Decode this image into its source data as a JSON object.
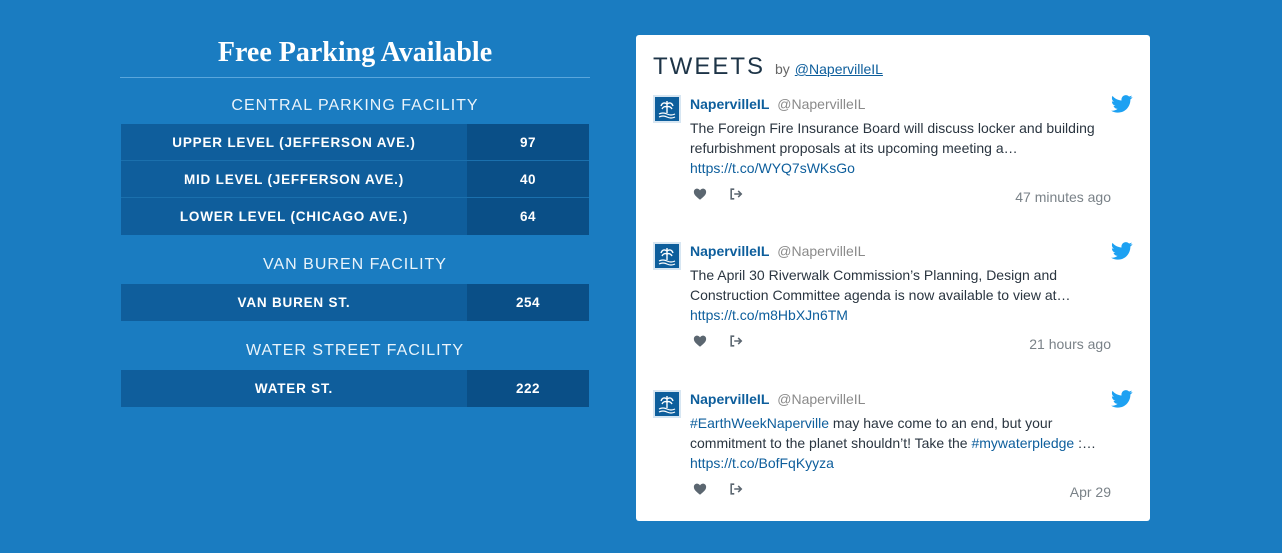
{
  "parking": {
    "title": "Free Parking Available",
    "facilities": [
      {
        "name": "CENTRAL PARKING FACILITY",
        "rows": [
          {
            "label": "UPPER LEVEL (JEFFERSON AVE.)",
            "count": "97"
          },
          {
            "label": "MID LEVEL (JEFFERSON AVE.)",
            "count": "40"
          },
          {
            "label": "LOWER LEVEL (CHICAGO AVE.)",
            "count": "64"
          }
        ]
      },
      {
        "name": "VAN BUREN FACILITY",
        "rows": [
          {
            "label": "VAN BUREN ST.",
            "count": "254"
          }
        ]
      },
      {
        "name": "WATER STREET FACILITY",
        "rows": [
          {
            "label": "WATER ST.",
            "count": "222"
          }
        ]
      }
    ]
  },
  "tweets": {
    "heading": "TWEETS",
    "by": "by",
    "handle": "@NapervilleIL",
    "items": [
      {
        "name": "NapervilleIL",
        "user": "@NapervilleIL",
        "text_parts": [
          {
            "t": "The Foreign Fire Insurance Board will discuss locker and building refurbishment proposals at its upcoming meeting a…",
            "link": false
          }
        ],
        "url": "https://t.co/WYQ7sWKsGo",
        "time": "47 minutes ago"
      },
      {
        "name": "NapervilleIL",
        "user": "@NapervilleIL",
        "text_parts": [
          {
            "t": "The April 30 Riverwalk Commission’s Planning, Design and Construction Committee agenda is now available to view at…",
            "link": false
          }
        ],
        "url": "https://t.co/m8HbXJn6TM",
        "time": "21 hours ago"
      },
      {
        "name": "NapervilleIL",
        "user": "@NapervilleIL",
        "text_parts": [
          {
            "t": "#EarthWeekNaperville",
            "link": true
          },
          {
            "t": " may have come to an end, but your commitment to the planet shouldn’t! Take the ",
            "link": false
          },
          {
            "t": "#mywaterpledge",
            "link": true
          },
          {
            "t": " :…",
            "link": false
          }
        ],
        "url": "https://t.co/BofFqKyyza",
        "time": "Apr 29"
      }
    ]
  },
  "colors": {
    "background": "#1a7cc1",
    "row_label_bg": "#0f5e9c",
    "row_value_bg": "#0a4f87",
    "link": "#0d5e9c",
    "twitter_bird": "#1da1f2"
  },
  "icons": [
    "twitter-bird-icon",
    "heart-icon",
    "share-icon",
    "city-logo-icon"
  ]
}
